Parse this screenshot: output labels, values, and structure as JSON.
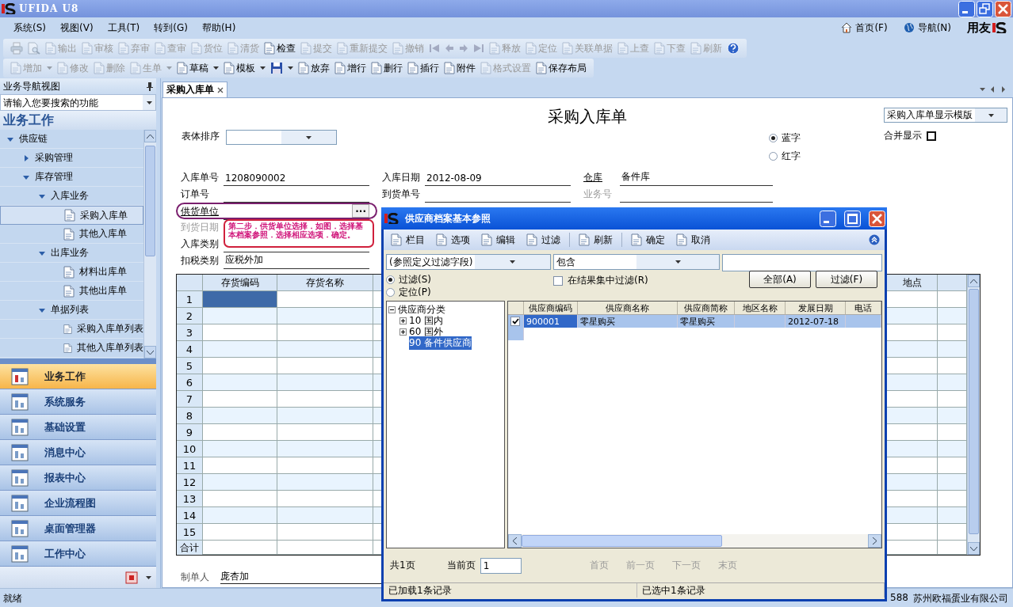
{
  "window": {
    "title": "UFIDA U8"
  },
  "menu": [
    "系统(S)",
    "视图(V)",
    "工具(T)",
    "转到(G)",
    "帮助(H)"
  ],
  "nav_links": [
    "首页(F)",
    "导航(N)"
  ],
  "brand": "用友",
  "toolbar_1": [
    {
      "kind": "icon",
      "disabled": true
    },
    {
      "kind": "icon",
      "disabled": true
    },
    {
      "kind": "text",
      "label": "输出",
      "disabled": true
    },
    {
      "kind": "text",
      "label": "审核",
      "disabled": true
    },
    {
      "kind": "text",
      "label": "弃审",
      "disabled": true
    },
    {
      "kind": "text",
      "label": "查审",
      "disabled": true
    },
    {
      "kind": "text",
      "label": "货位",
      "disabled": true
    },
    {
      "kind": "text",
      "label": "清货",
      "disabled": true
    },
    {
      "kind": "text",
      "label": "检查",
      "disabled": false
    },
    {
      "kind": "text",
      "label": "提交",
      "disabled": true
    },
    {
      "kind": "text",
      "label": "重新提交",
      "disabled": true
    },
    {
      "kind": "text",
      "label": "撤销",
      "disabled": true
    },
    {
      "kind": "icon",
      "disabled": true
    },
    {
      "kind": "icon",
      "disabled": true
    },
    {
      "kind": "icon",
      "disabled": true
    },
    {
      "kind": "icon",
      "disabled": true
    },
    {
      "kind": "text",
      "label": "释放",
      "disabled": true
    },
    {
      "kind": "text",
      "label": "定位",
      "disabled": true
    },
    {
      "kind": "text",
      "label": "关联单据",
      "disabled": true
    },
    {
      "kind": "text",
      "label": "上查",
      "disabled": true
    },
    {
      "kind": "text",
      "label": "下查",
      "disabled": true
    },
    {
      "kind": "text",
      "label": "刷新",
      "disabled": true
    },
    {
      "kind": "icon",
      "disabled": false
    }
  ],
  "toolbar_2": [
    {
      "kind": "text",
      "label": "增加",
      "disabled": true,
      "dropdown": true
    },
    {
      "kind": "text",
      "label": "修改",
      "disabled": true,
      "dropdown": false
    },
    {
      "kind": "text",
      "label": "删除",
      "disabled": true,
      "dropdown": false
    },
    {
      "kind": "text",
      "label": "生单",
      "disabled": true,
      "dropdown": true
    },
    {
      "kind": "text",
      "label": "草稿",
      "disabled": false,
      "dropdown": true
    },
    {
      "kind": "text",
      "label": "模板",
      "disabled": false,
      "dropdown": true
    },
    {
      "kind": "icon",
      "disabled": false,
      "dropdown": true
    },
    {
      "kind": "text",
      "label": "放弃",
      "disabled": false,
      "dropdown": false
    },
    {
      "kind": "text",
      "label": "增行",
      "disabled": false,
      "dropdown": false
    },
    {
      "kind": "text",
      "label": "删行",
      "disabled": false,
      "dropdown": false
    },
    {
      "kind": "text",
      "label": "插行",
      "disabled": false,
      "dropdown": false
    },
    {
      "kind": "text",
      "label": "附件",
      "disabled": false,
      "dropdown": false
    },
    {
      "kind": "text",
      "label": "格式设置",
      "disabled": true,
      "dropdown": false
    },
    {
      "kind": "text",
      "label": "保存布局",
      "disabled": false,
      "dropdown": false
    }
  ],
  "sidebar": {
    "title": "业务导航视图",
    "search": {
      "placeholder": "请输入您要搜索的功能"
    },
    "section": "业务工作",
    "tree": [
      {
        "label": "供应链",
        "kind": "folder",
        "expanded": true,
        "selected": false,
        "children": [
          {
            "label": "采购管理",
            "kind": "folder",
            "expanded": false,
            "selected": false
          },
          {
            "label": "库存管理",
            "kind": "folder",
            "expanded": true,
            "selected": false,
            "children": [
              {
                "label": "入库业务",
                "kind": "folder",
                "expanded": true,
                "selected": false,
                "children": [
                  {
                    "label": "采购入库单",
                    "kind": "document",
                    "selected": true
                  },
                  {
                    "label": "其他入库单",
                    "kind": "document",
                    "selected": false
                  }
                ]
              },
              {
                "label": "出库业务",
                "kind": "folder",
                "expanded": true,
                "selected": false,
                "children": [
                  {
                    "label": "材料出库单",
                    "kind": "document",
                    "selected": false
                  },
                  {
                    "label": "其他出库单",
                    "kind": "document",
                    "selected": false
                  }
                ]
              },
              {
                "label": "单据列表",
                "kind": "folder",
                "expanded": true,
                "selected": false,
                "children": [
                  {
                    "label": "采购入库单列表",
                    "kind": "document",
                    "selected": false
                  },
                  {
                    "label": "其他入库单列表",
                    "kind": "document",
                    "selected": false
                  }
                ]
              }
            ]
          }
        ]
      }
    ],
    "modules": [
      {
        "label": "业务工作",
        "selected": true
      },
      {
        "label": "系统服务",
        "selected": false
      },
      {
        "label": "基础设置",
        "selected": false
      },
      {
        "label": "消息中心",
        "selected": false
      },
      {
        "label": "报表中心",
        "selected": false
      },
      {
        "label": "企业流程图",
        "selected": false
      },
      {
        "label": "桌面管理器",
        "selected": false
      },
      {
        "label": "工作中心",
        "selected": false
      }
    ]
  },
  "tabs": [
    {
      "label": "采购入库单",
      "selected": true
    }
  ],
  "form": {
    "title": "采购入库单",
    "template": "采购入库单显示模版",
    "sort_label": "表体排序",
    "colors": [
      {
        "label": "蓝字",
        "selected": true
      },
      {
        "label": "红字",
        "selected": false
      }
    ],
    "merge": {
      "label": "合并显示",
      "checked": false
    },
    "fields": [
      [
        {
          "label": "入库单号",
          "value": "1208090002",
          "kind": "text",
          "disabled": false
        },
        {
          "label": "入库日期",
          "value": "2012-08-09",
          "kind": "text",
          "disabled": false
        },
        {
          "label": "仓库",
          "value": "备件库",
          "kind": "reference",
          "disabled": false
        }
      ],
      [
        {
          "label": "订单号",
          "kind": "text",
          "disabled": false
        },
        {
          "label": "到货单号",
          "kind": "text",
          "disabled": false
        },
        {
          "label": "业务号",
          "kind": "text",
          "disabled": true
        }
      ],
      [
        {
          "label": "供货单位",
          "kind": "reference",
          "disabled": false,
          "browse_button": "...",
          "highlighted": true
        }
      ],
      [
        {
          "label": "到货日期",
          "kind": "text",
          "disabled": true
        }
      ],
      [
        {
          "label": "入库类别",
          "kind": "text",
          "disabled": false
        }
      ],
      [
        {
          "label": "扣税类别",
          "value": "应税外加",
          "kind": "text",
          "disabled": false
        }
      ]
    ],
    "annotation": "第二步．供货单位选择．如图．选择基本档案参照．选择相应选项．确定。",
    "grid": {
      "columns": [
        "存货编码",
        "存货名称",
        "地点"
      ],
      "rows": [
        {
          "label": "1",
          "selected": true
        },
        {
          "label": "2",
          "selected": false
        },
        {
          "label": "3",
          "selected": false
        },
        {
          "label": "4",
          "selected": false
        },
        {
          "label": "5",
          "selected": false
        },
        {
          "label": "6",
          "selected": false
        },
        {
          "label": "7",
          "selected": false
        },
        {
          "label": "8",
          "selected": false
        },
        {
          "label": "9",
          "selected": false
        },
        {
          "label": "10",
          "selected": false
        },
        {
          "label": "11",
          "selected": false
        },
        {
          "label": "12",
          "selected": false
        },
        {
          "label": "13",
          "selected": false
        },
        {
          "label": "14",
          "selected": false
        },
        {
          "label": "15",
          "selected": false
        }
      ],
      "total_label": "合计"
    },
    "maker": {
      "label": "制单人",
      "value": "庞杏加"
    }
  },
  "dialog": {
    "title": "供应商档案基本参照",
    "toolbar": [
      "栏目",
      "选项",
      "编辑",
      "过滤",
      "刷新",
      "确定",
      "取消"
    ],
    "filter": {
      "field": "(参照定义过滤字段)",
      "operator": "包含",
      "modes": [
        {
          "label": "过滤(S)",
          "selected": true
        },
        {
          "label": "定位(P)",
          "selected": false
        }
      ],
      "in_result": {
        "label": "在结果集中过滤(R)",
        "checked": false
      },
      "buttons": [
        "全部(A)",
        "过滤(F)"
      ]
    },
    "tree": {
      "label": "供应商分类",
      "expanded": true,
      "children": [
        {
          "label": "10 国内",
          "expanded": false,
          "selected": false
        },
        {
          "label": "60 国外",
          "expanded": false,
          "selected": false
        },
        {
          "label": "90 备件供应商",
          "selected": true
        }
      ]
    },
    "table": {
      "columns": [
        "供应商编码",
        "供应商名称",
        "供应商简称",
        "地区名称",
        "发展日期",
        "电话"
      ],
      "rows": [
        {
          "checked": true,
          "selected": true,
          "code": "900001",
          "name": "零星购买",
          "short_name": "零星购买",
          "date": "2012-07-18"
        }
      ]
    },
    "pager": {
      "total": "共1页",
      "current_label": "当前页",
      "current": "1",
      "links": [
        "首页",
        "前一页",
        "下一页",
        "末页"
      ],
      "links_disabled": true
    },
    "status": [
      "已加载1条记录",
      "已选中1条记录"
    ]
  },
  "status_bar": {
    "text": "就绪",
    "cut_text": "588",
    "company": "苏州欧福蛋业有限公司"
  }
}
